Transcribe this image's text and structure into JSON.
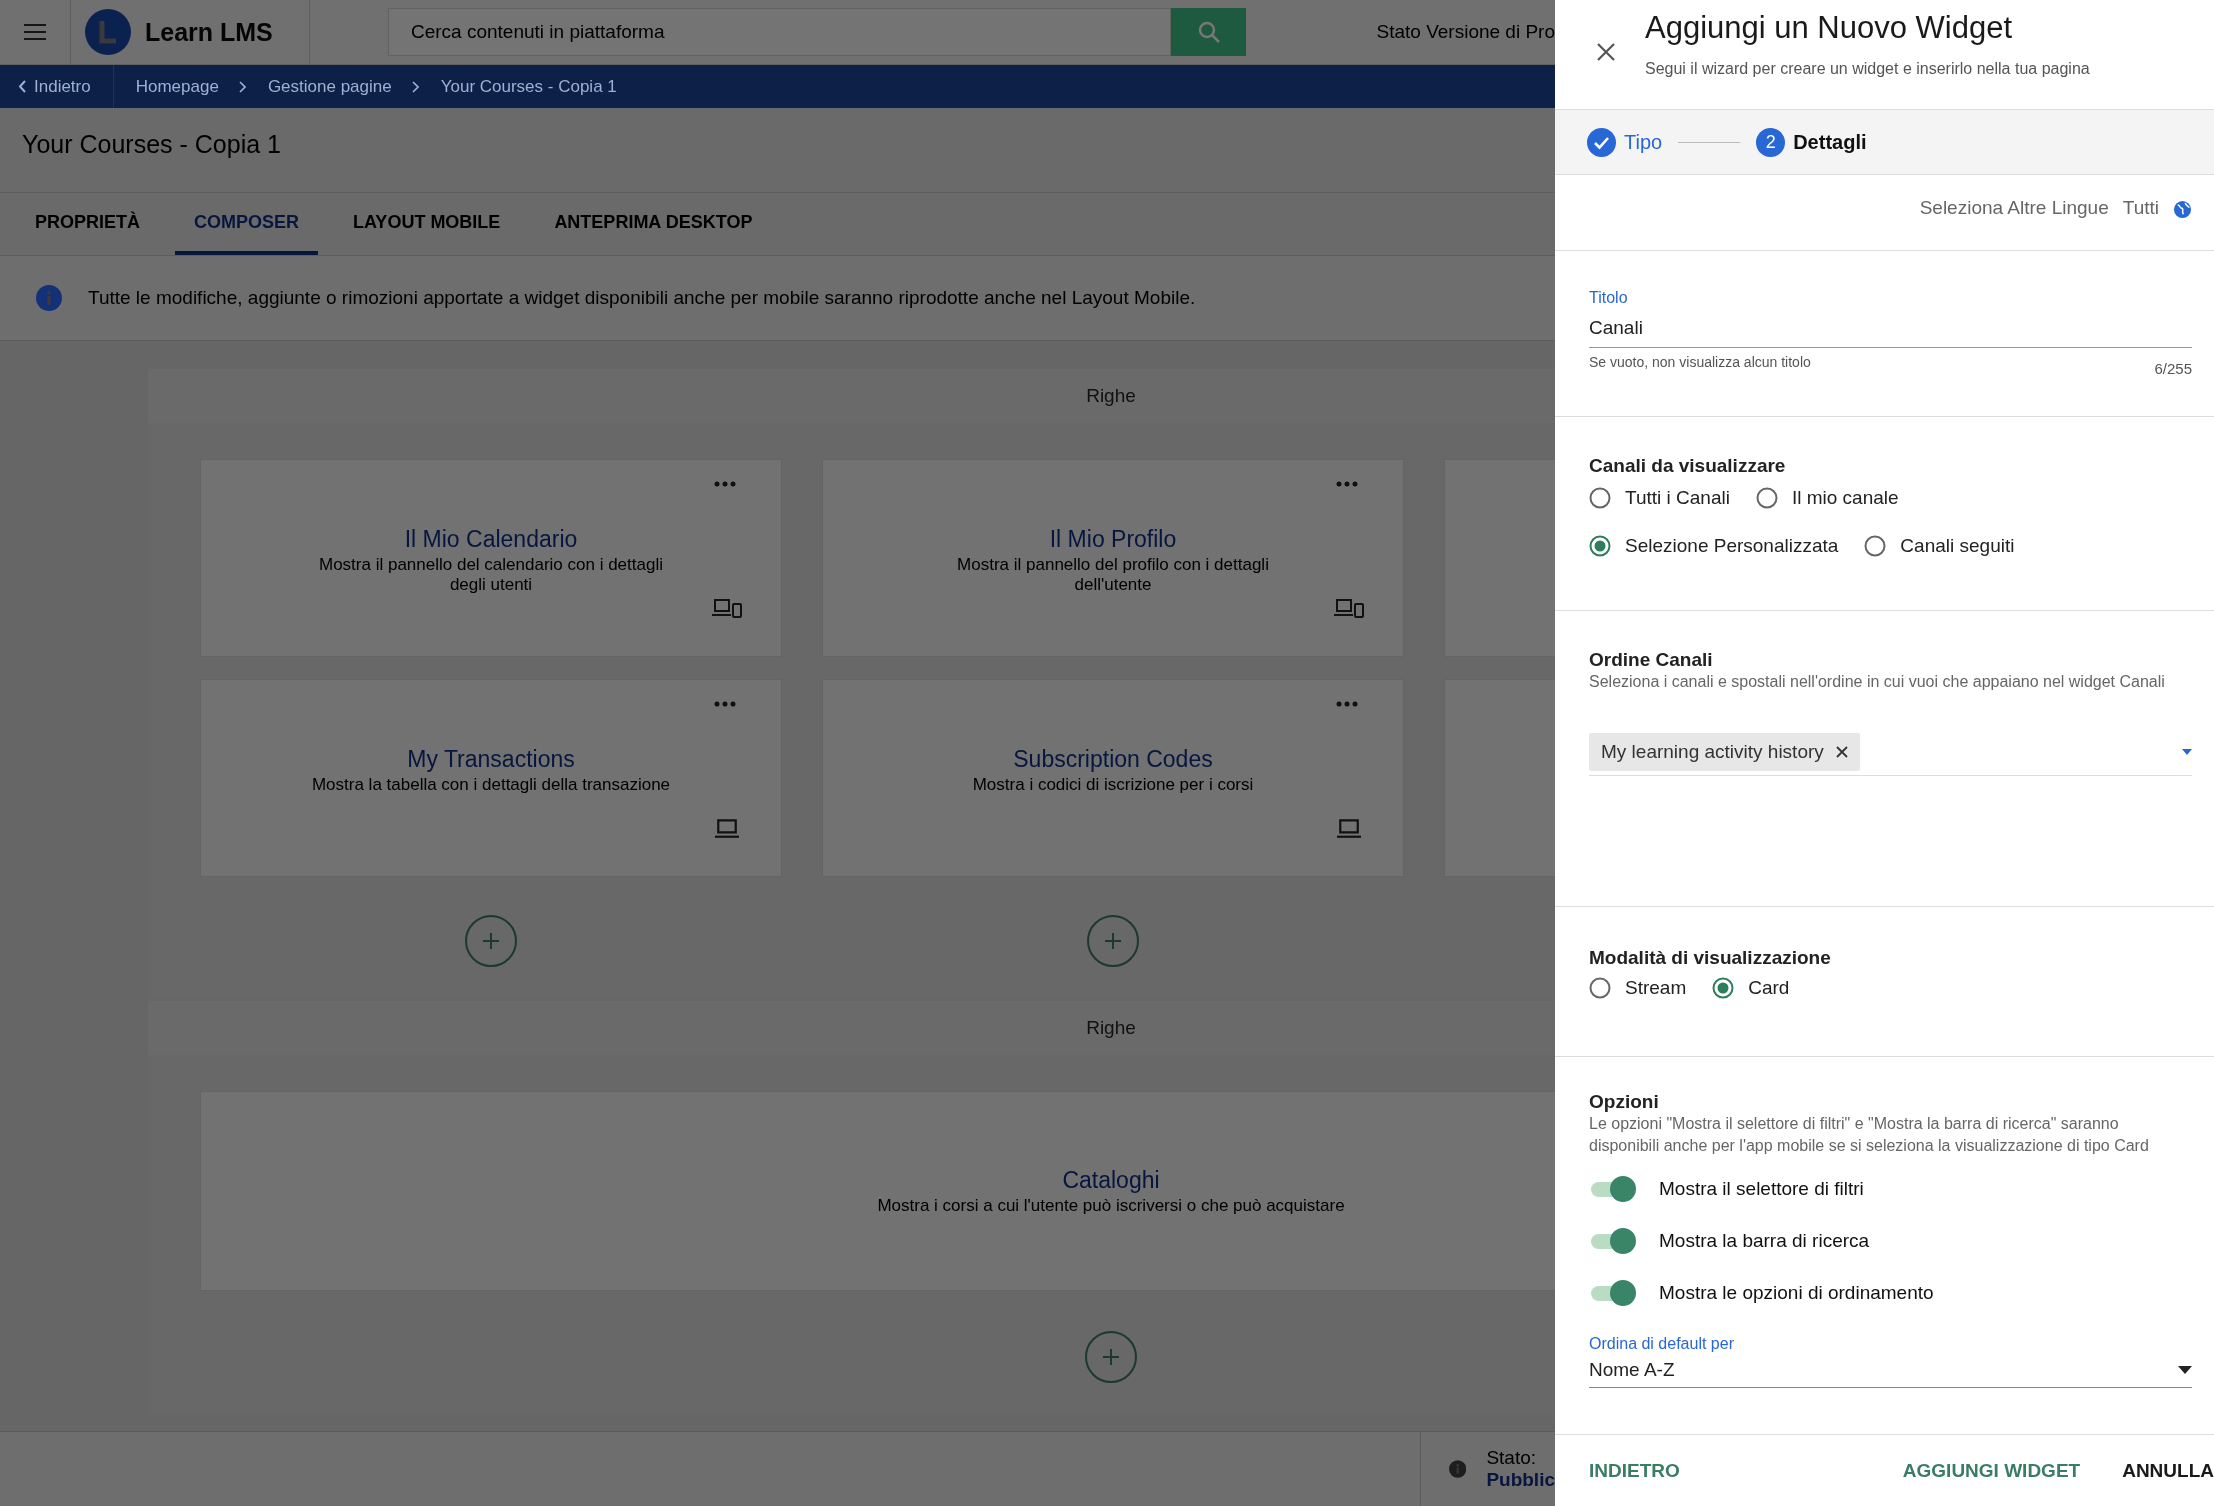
{
  "header": {
    "logo_text": "Learn LMS",
    "search": {
      "placeholder": "Cerca contenuti in piattaforma"
    },
    "version_label": "Stato Versione di Pro"
  },
  "breadcrumb": {
    "back": "Indietro",
    "items": [
      "Homepage",
      "Gestione pagine",
      "Your Courses - Copia 1"
    ]
  },
  "page": {
    "title": "Your Courses - Copia 1",
    "tabs": [
      {
        "label": "PROPRIETÀ",
        "selected": false
      },
      {
        "label": "COMPOSER",
        "selected": true
      },
      {
        "label": "LAYOUT MOBILE",
        "selected": false
      },
      {
        "label": "ANTEPRIMA DESKTOP",
        "selected": false
      }
    ],
    "info": "Tutte le modifiche, aggiunte o rimozioni apportate a widget disponibili anche per mobile saranno riprodotte anche nel Layout Mobile."
  },
  "rows": [
    {
      "label": "Righe",
      "kind": "grid",
      "widgets": [
        {
          "kind": "all_devices",
          "title": "Il Mio Calendario",
          "description": "Mostra il pannello del calendario con i dettagli degli utenti"
        },
        {
          "kind": "all_devices",
          "title": "Il Mio Profilo",
          "description": "Mostra il pannello del profilo con i dettagli dell'utente"
        },
        {
          "kind": "clipped"
        },
        {
          "kind": "desktop_only",
          "title": "My Transactions",
          "description": "Mostra la tabella con i dettagli della transazione"
        },
        {
          "kind": "desktop_only",
          "title": "Subscription Codes",
          "description": "Mostra i codici di iscrizione per i corsi"
        },
        {
          "kind": "clipped"
        }
      ]
    },
    {
      "label": "Righe",
      "kind": "wide",
      "widgets": [
        {
          "kind": "plain",
          "title": "Cataloghi",
          "description": "Mostra i corsi a cui l'utente può iscriversi o che può acquistare"
        }
      ]
    }
  ],
  "status": {
    "label": "Stato:",
    "value": "Pubblic"
  },
  "panel": {
    "title": "Aggiungi un Nuovo Widget",
    "subtitle": "Segui il wizard per creare un widget e inserirlo nella tua pagina",
    "steps": [
      {
        "label": "Tipo",
        "kind": "done"
      },
      {
        "label": "Dettagli",
        "number": "2",
        "kind": "current"
      }
    ],
    "language": {
      "label": "Seleziona Altre Lingue",
      "value": "Tutti"
    },
    "title_field": {
      "label": "Titolo",
      "value": "Canali",
      "hint": "Se vuoto, non visualizza alcun titolo",
      "counter": "6/255"
    },
    "channels": {
      "heading": "Canali da visualizzare",
      "option_rows": [
        [
          {
            "label": "Tutti i Canali",
            "selected": false
          },
          {
            "label": "Il mio canale",
            "selected": false
          }
        ],
        [
          {
            "label": "Selezione Personalizzata",
            "selected": true
          },
          {
            "label": "Canali seguiti",
            "selected": false
          }
        ]
      ]
    },
    "order": {
      "heading": "Ordine Canali",
      "description": "Seleziona i canali e spostali nell'ordine in cui vuoi che appaiano nel widget Canali",
      "chips": [
        {
          "label": "My learning activity history"
        }
      ]
    },
    "display_mode": {
      "heading": "Modalità di visualizzazione",
      "options": [
        {
          "label": "Stream",
          "selected": false
        },
        {
          "label": "Card",
          "selected": true
        }
      ]
    },
    "options": {
      "heading": "Opzioni",
      "description": "Le opzioni \"Mostra il selettore di filtri\" e \"Mostra la barra di ricerca\" saranno disponibili anche per l'app mobile se si seleziona la visualizzazione di tipo Card",
      "toggles": [
        {
          "label": "Mostra il selettore di filtri",
          "on": true
        },
        {
          "label": "Mostra la barra di ricerca",
          "on": true
        },
        {
          "label": "Mostra le opzioni di ordinamento",
          "on": true
        }
      ],
      "sort": {
        "label": "Ordina di default per",
        "value": "Nome A-Z"
      }
    },
    "footer": {
      "back": "INDIETRO",
      "add": "AGGIUNGI WIDGET",
      "cancel": "ANNULLA"
    }
  }
}
